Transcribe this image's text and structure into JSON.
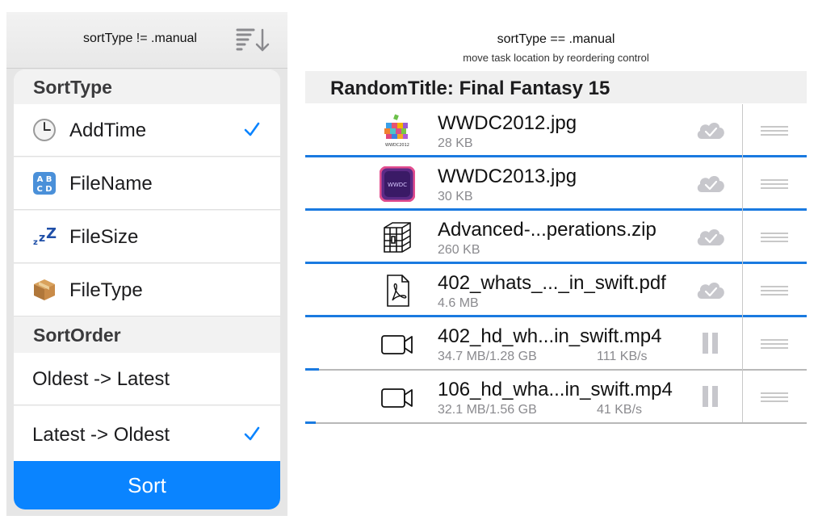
{
  "left": {
    "title": "sortType != .manual",
    "sort_icon": "sort-descending-icon",
    "sections": [
      {
        "header": "SortType",
        "rows": [
          {
            "label": "AddTime",
            "icon": "clock-icon",
            "checked": true
          },
          {
            "label": "FileName",
            "icon": "abcd-icon",
            "checked": false
          },
          {
            "label": "FileSize",
            "icon": "zzz-icon",
            "checked": false
          },
          {
            "label": "FileType",
            "icon": "package-icon",
            "checked": false
          }
        ]
      },
      {
        "header": "SortOrder",
        "rows": [
          {
            "label": "Oldest -> Latest",
            "checked": false
          },
          {
            "label": "Latest -> Oldest",
            "checked": true
          }
        ]
      }
    ],
    "sort_button": "Sort",
    "accent": "#0a84ff"
  },
  "right": {
    "title": "sortType == .manual",
    "subtitle": "move task location by reordering control",
    "section_header": "RandomTitle: Final Fantasy 15",
    "tasks": [
      {
        "name": "WWDC2012.jpg",
        "size": "28 KB",
        "speed": "",
        "icon": "wwdc2012-thumbnail",
        "thumb_text": "WWDC2012",
        "status": "cloud-check-icon",
        "progress": 1.0
      },
      {
        "name": "WWDC2013.jpg",
        "size": "30 KB",
        "speed": "",
        "icon": "wwdc2013-thumbnail",
        "thumb_text": "WWDC",
        "status": "cloud-check-icon",
        "progress": 1.0
      },
      {
        "name": "Advanced-...perations.zip",
        "size": "260 KB",
        "speed": "",
        "icon": "zip-archive-icon",
        "status": "cloud-check-icon",
        "progress": 1.0
      },
      {
        "name": "402_whats_..._in_swift.pdf",
        "size": "4.6 MB",
        "speed": "",
        "icon": "pdf-document-icon",
        "status": "cloud-check-icon",
        "progress": 1.0
      },
      {
        "name": "402_hd_wh...in_swift.mp4",
        "size": "34.7 MB/1.28 GB",
        "speed": "111 KB/s",
        "icon": "video-camera-icon",
        "status": "pause-icon",
        "progress": 0.027
      },
      {
        "name": "106_hd_wha...in_swift.mp4",
        "size": "32.1 MB/1.56 GB",
        "speed": "41 KB/s",
        "icon": "video-camera-icon",
        "status": "pause-icon",
        "progress": 0.021
      }
    ],
    "progress_color": "#1a7ae0"
  }
}
